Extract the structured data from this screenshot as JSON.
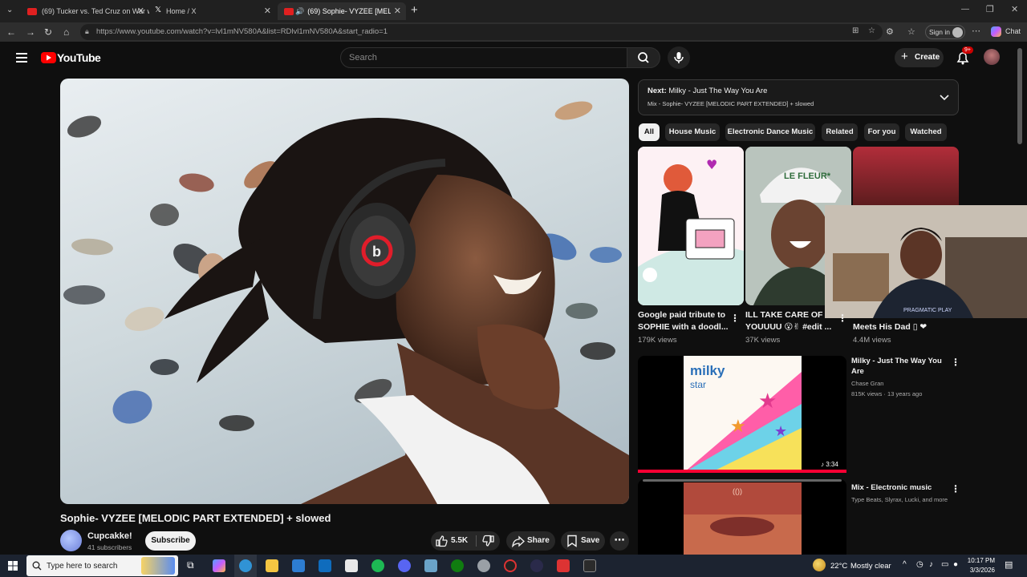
{
  "browser": {
    "tabs": [
      {
        "label": "(69) Tucker vs. Ted Cruz on War wi",
        "fav_color": "#e02020"
      },
      {
        "label": "Home / X",
        "fav_color": "#ffffff"
      },
      {
        "label": "(69) Sophie- VYZEE [MELODIC",
        "fav_color": "#e02020"
      }
    ],
    "url": "https://www.youtube.com/watch?v=lvl1mNV580A&list=RDlvl1mNV580A&start_radio=1",
    "url_host": "www.youtube.com",
    "sign_in_label": "Sign in",
    "chat_label": "Chat"
  },
  "masthead": {
    "logo_text": "YouTube",
    "search_placeholder": "Search",
    "create_label": "Create",
    "notif_badge": "9+"
  },
  "video": {
    "title": "Sophie- VYZEE [MELODIC PART EXTENDED] + slowed",
    "channel_name": "Cupcakke!",
    "subscribers": "41 subscribers",
    "subscribe_label": "Subscribe",
    "likes": "5.5K",
    "share_label": "Share",
    "save_label": "Save",
    "logo_letter": "b"
  },
  "up_next": {
    "prefix": "Next:",
    "title": "Milky - Just The Way You Are",
    "subtitle": "Mix - Sophie- VYZEE [MELODIC PART EXTENDED] + slowed"
  },
  "chips": [
    "All",
    "House Music",
    "Electronic Dance Music",
    "Related",
    "For you",
    "Watched"
  ],
  "cards": [
    {
      "title1": "Google paid tribute to",
      "title2": "SOPHIE with a doodl...",
      "views": "179K views"
    },
    {
      "title1": "ILL TAKE CARE OF",
      "title2": "YOUUUU 😮✌ #edit ...",
      "views": "37K views"
    },
    {
      "title1": "",
      "title2": "Meets His Dad ▯ ❤",
      "views": "4.4M views"
    }
  ],
  "card_thumb_texts": {
    "cap": "LE FLEUR*",
    "overlay_logo": "PRAGMATIC PLAY"
  },
  "list": [
    {
      "title1": "Milky - Just The Way You",
      "title2": "Are",
      "meta1": "Chase Gran",
      "meta2": "815K views · 13 years ago",
      "duration": "♪ 3:34",
      "thumb_text1": "milky",
      "thumb_text2": "star"
    },
    {
      "title1": "Mix - Electronic music",
      "title2": "",
      "meta1": "Type Beats, Slyrax, Lucki, and more",
      "meta2": "",
      "duration": "",
      "thumb_text1": "(())",
      "thumb_text2": ""
    }
  ],
  "taskbar": {
    "search_placeholder": "Type here to search",
    "weather_temp": "22°C",
    "weather_text": "Mostly clear",
    "time": "10:17 PM",
    "date": "3/3/2026"
  }
}
